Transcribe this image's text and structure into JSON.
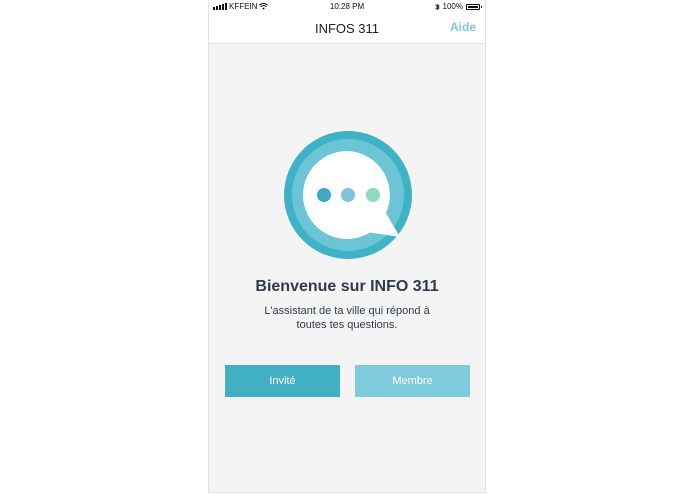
{
  "status_bar": {
    "carrier": "KFFEIN",
    "time": "10:28 PM",
    "battery": "100%"
  },
  "nav": {
    "title": "INFOS 311",
    "help_label": "Aide"
  },
  "welcome": {
    "title": "Bienvenue sur INFO 311",
    "subtitle_line1": "L'assistant de ta ville qui répond à",
    "subtitle_line2": "toutes tes questions."
  },
  "buttons": {
    "guest_label": "Invité",
    "member_label": "Membre"
  },
  "colors": {
    "accent": "#41b0c4",
    "accent_light": "#80cade",
    "help_link": "#7cc8df",
    "text_dark": "#2f3b4a",
    "dot_1": "#3fa8c2",
    "dot_2": "#7ec4da",
    "dot_3": "#8dd9c4"
  },
  "icons": [
    "signal-icon",
    "wifi-icon",
    "bluetooth-icon",
    "battery-icon",
    "chat-bubble-logo-icon"
  ]
}
